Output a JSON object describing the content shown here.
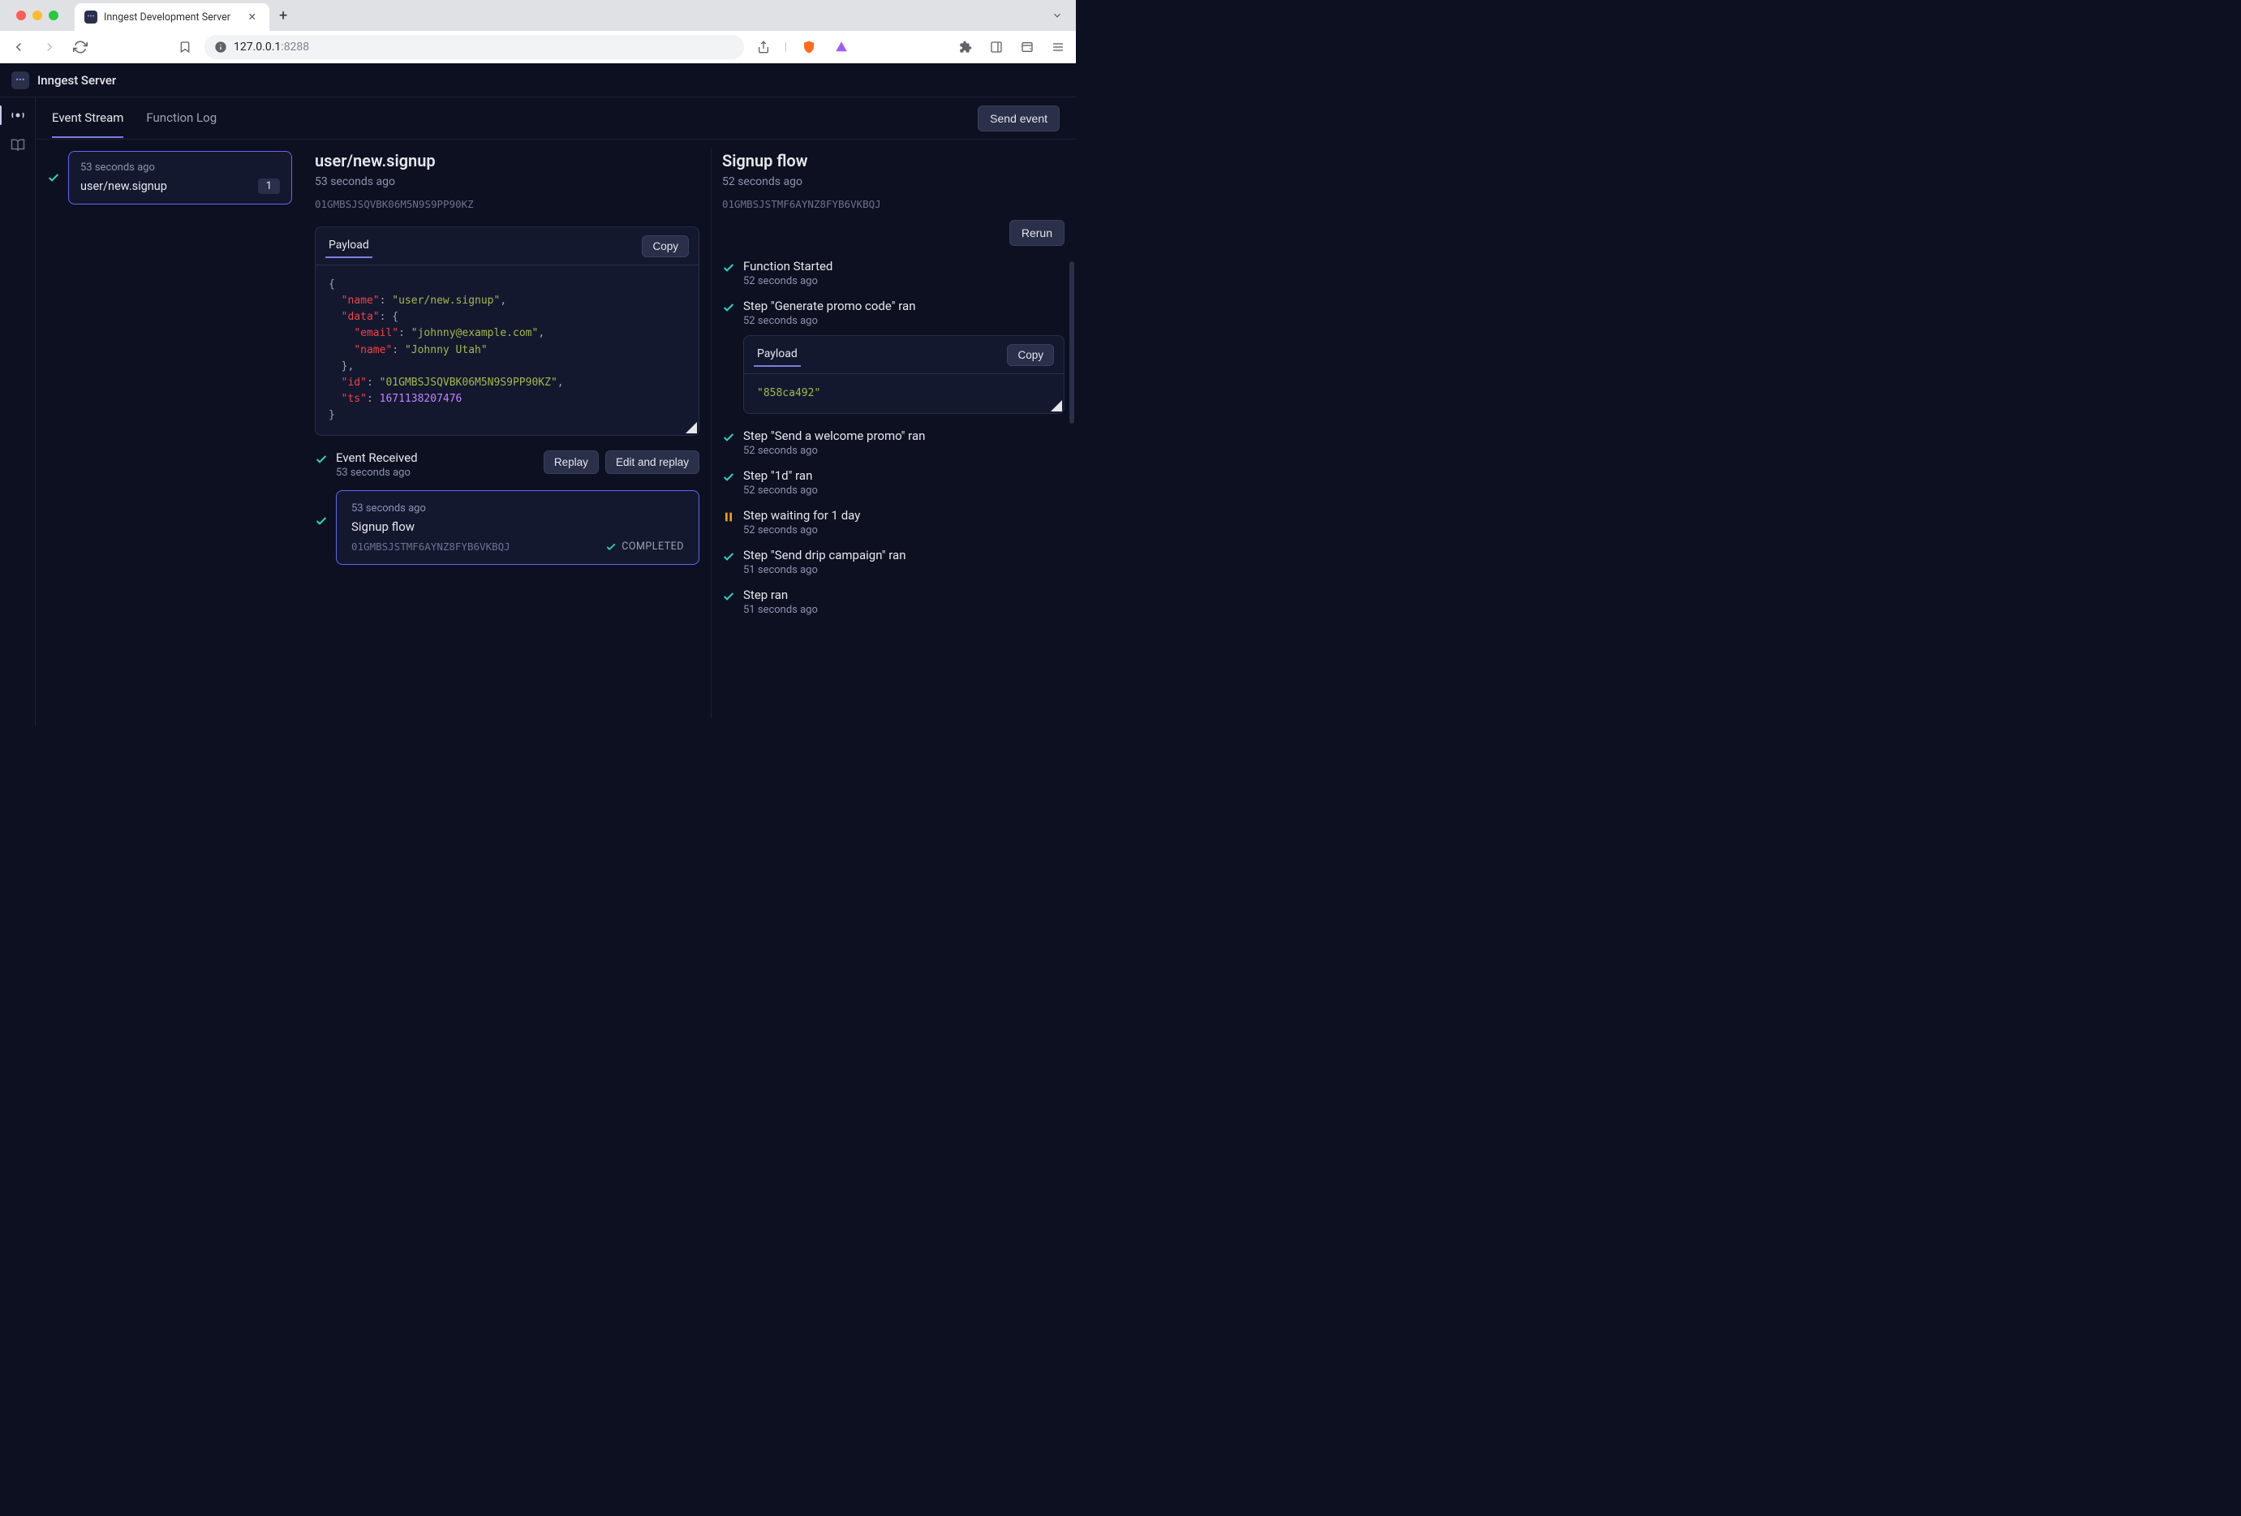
{
  "browser": {
    "tab_title": "Inngest Development Server",
    "url_host": "127.0.0.1",
    "url_port": ":8288"
  },
  "app": {
    "title": "Inngest Server"
  },
  "tabs": {
    "event_stream": "Event Stream",
    "function_log": "Function Log"
  },
  "send_event": "Send event",
  "event_card": {
    "ts": "53 seconds ago",
    "name": "user/new.signup",
    "count": "1"
  },
  "detail": {
    "title": "user/new.signup",
    "ts": "53 seconds ago",
    "id": "01GMBSJSQVBK06M5N9S9PP90KZ",
    "payload_tab": "Payload",
    "copy": "Copy",
    "json_name_key": "\"name\"",
    "json_name_val": "\"user/new.signup\"",
    "json_data_key": "\"data\"",
    "json_email_key": "\"email\"",
    "json_email_val": "\"johnny@example.com\"",
    "json_iname_key": "\"name\"",
    "json_iname_val": "\"Johnny Utah\"",
    "json_id_key": "\"id\"",
    "json_id_val": "\"01GMBSJSQVBK06M5N9S9PP90KZ\"",
    "json_ts_key": "\"ts\"",
    "json_ts_val": "1671138207476"
  },
  "event_received": {
    "title": "Event Received",
    "ts": "53 seconds ago",
    "replay": "Replay",
    "edit_replay": "Edit and replay"
  },
  "flow_box": {
    "ts": "53 seconds ago",
    "name": "Signup flow",
    "id": "01GMBSJSTMF6AYNZ8FYB6VKBQJ",
    "status": "COMPLETED"
  },
  "right": {
    "title": "Signup flow",
    "ts": "52 seconds ago",
    "id": "01GMBSJSTMF6AYNZ8FYB6VKBQJ",
    "rerun": "Rerun",
    "steps": [
      {
        "title": "Function Started",
        "ts": "52 seconds ago",
        "icon": "check"
      },
      {
        "title": "Step \"Generate promo code\" ran",
        "ts": "52 seconds ago",
        "icon": "check",
        "payload": "\"858ca492\"",
        "payload_tab": "Payload",
        "copy": "Copy"
      },
      {
        "title": "Step \"Send a welcome promo\" ran",
        "ts": "52 seconds ago",
        "icon": "check"
      },
      {
        "title": "Step \"1d\" ran",
        "ts": "52 seconds ago",
        "icon": "check"
      },
      {
        "title": "Step waiting for 1 day",
        "ts": "52 seconds ago",
        "icon": "pause"
      },
      {
        "title": "Step \"Send drip campaign\" ran",
        "ts": "51 seconds ago",
        "icon": "check"
      },
      {
        "title": "Step ran",
        "ts": "51 seconds ago",
        "icon": "check"
      }
    ]
  }
}
